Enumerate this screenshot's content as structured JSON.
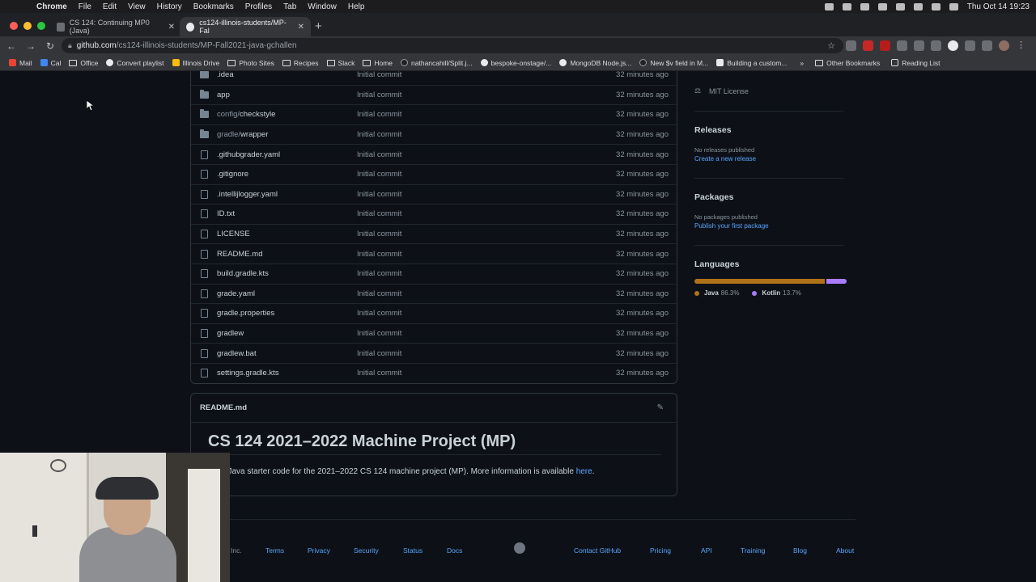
{
  "menubar": {
    "app": "Chrome",
    "items": [
      "File",
      "Edit",
      "View",
      "History",
      "Bookmarks",
      "Profiles",
      "Tab",
      "Window",
      "Help"
    ],
    "datetime": "Thu Oct 14  19:23"
  },
  "tabs": [
    {
      "title": "CS 124: Continuing MP0 (Java)",
      "active": false
    },
    {
      "title": "cs124-illinois-students/MP-Fal",
      "active": true
    }
  ],
  "address": {
    "host": "github.com",
    "path": "/cs124-illinois-students/MP-Fall2021-java-gchallen"
  },
  "bookmarks": {
    "items": [
      {
        "label": "Mail"
      },
      {
        "label": "Cal"
      },
      {
        "label": "Office"
      },
      {
        "label": "Convert playlist"
      },
      {
        "label": "Illinois Drive"
      },
      {
        "label": "Photo Sites"
      },
      {
        "label": "Recipes"
      },
      {
        "label": "Slack"
      },
      {
        "label": "Home"
      },
      {
        "label": "nathancahill/Split.j..."
      },
      {
        "label": "bespoke-onstage/..."
      },
      {
        "label": "MongoDB Node.js..."
      },
      {
        "label": "New $v field in M..."
      },
      {
        "label": "Building a custom..."
      }
    ],
    "more": "»",
    "other": "Other Bookmarks",
    "reading": "Reading List"
  },
  "files": [
    {
      "name": ".idea",
      "dim": "",
      "type": "dir",
      "message": "Initial commit",
      "age": "32 minutes ago"
    },
    {
      "name": "app",
      "dim": "",
      "type": "dir",
      "message": "Initial commit",
      "age": "32 minutes ago"
    },
    {
      "name": "checkstyle",
      "dim": "config/",
      "type": "dir",
      "message": "Initial commit",
      "age": "32 minutes ago"
    },
    {
      "name": "wrapper",
      "dim": "gradle/",
      "type": "dir",
      "message": "Initial commit",
      "age": "32 minutes ago"
    },
    {
      "name": ".githubgrader.yaml",
      "dim": "",
      "type": "file",
      "message": "Initial commit",
      "age": "32 minutes ago"
    },
    {
      "name": ".gitignore",
      "dim": "",
      "type": "file",
      "message": "Initial commit",
      "age": "32 minutes ago"
    },
    {
      "name": ".intellijlogger.yaml",
      "dim": "",
      "type": "file",
      "message": "Initial commit",
      "age": "32 minutes ago"
    },
    {
      "name": "ID.txt",
      "dim": "",
      "type": "file",
      "message": "Initial commit",
      "age": "32 minutes ago"
    },
    {
      "name": "LICENSE",
      "dim": "",
      "type": "file",
      "message": "Initial commit",
      "age": "32 minutes ago"
    },
    {
      "name": "README.md",
      "dim": "",
      "type": "file",
      "message": "Initial commit",
      "age": "32 minutes ago"
    },
    {
      "name": "build.gradle.kts",
      "dim": "",
      "type": "file",
      "message": "Initial commit",
      "age": "32 minutes ago"
    },
    {
      "name": "grade.yaml",
      "dim": "",
      "type": "file",
      "message": "Initial commit",
      "age": "32 minutes ago"
    },
    {
      "name": "gradle.properties",
      "dim": "",
      "type": "file",
      "message": "Initial commit",
      "age": "32 minutes ago"
    },
    {
      "name": "gradlew",
      "dim": "",
      "type": "file",
      "message": "Initial commit",
      "age": "32 minutes ago"
    },
    {
      "name": "gradlew.bat",
      "dim": "",
      "type": "file",
      "message": "Initial commit",
      "age": "32 minutes ago"
    },
    {
      "name": "settings.gradle.kts",
      "dim": "",
      "type": "file",
      "message": "Initial commit",
      "age": "32 minutes ago"
    }
  ],
  "readme": {
    "filename": "README.md",
    "heading": "CS 124 2021–2022 Machine Project (MP)",
    "text": "s the Java starter code for the 2021–2022 CS 124 machine project (MP). More information is available ",
    "link": "here",
    "trailing": "."
  },
  "sidebar": {
    "license": "MIT License",
    "releases": {
      "title": "Releases",
      "empty": "No releases published",
      "link": "Create a new release"
    },
    "packages": {
      "title": "Packages",
      "empty": "No packages published",
      "link": "Publish your first package"
    },
    "languages": {
      "title": "Languages",
      "items": [
        {
          "name": "Java",
          "percent": "86.3%",
          "fraction": 0.863,
          "color": "#b07219"
        },
        {
          "name": "Kotlin",
          "percent": "13.7%",
          "fraction": 0.137,
          "color": "#a97bff"
        }
      ]
    }
  },
  "footer": {
    "copyright": "Inc.",
    "left": [
      "Terms",
      "Privacy",
      "Security",
      "Status",
      "Docs"
    ],
    "right": [
      "Contact GitHub",
      "Pricing",
      "API",
      "Training",
      "Blog",
      "About"
    ]
  }
}
